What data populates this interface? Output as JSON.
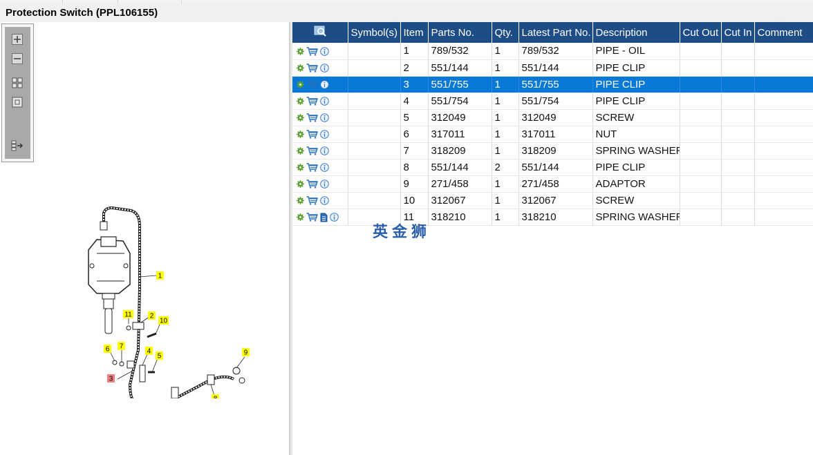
{
  "window": {
    "title": "Protection Switch (PPL106155)"
  },
  "toolbox": {
    "tools": [
      {
        "icon": "zoom-in-icon"
      },
      {
        "icon": "zoom-out-icon"
      },
      {
        "icon": "fit-all-icon"
      },
      {
        "icon": "actual-size-icon"
      },
      {
        "icon": "split-layout-icon"
      }
    ]
  },
  "diagram": {
    "callouts": [
      "1",
      "2",
      "3",
      "4",
      "5",
      "6",
      "7",
      "8",
      "8",
      "9",
      "10",
      "11"
    ],
    "highlighted_callout": "3"
  },
  "table": {
    "headers": {
      "symbols": "Symbol(s)",
      "item": "Item",
      "parts_no": "Parts No.",
      "qty": "Qty.",
      "latest_part_no": "Latest Part No.",
      "description": "Description",
      "cut_out": "Cut Out",
      "cut_in": "Cut In",
      "comment": "Comment"
    },
    "rows": [
      {
        "item": "1",
        "parts_no": "789/532",
        "qty": "1",
        "latest": "789/532",
        "description": "PIPE - OIL"
      },
      {
        "item": "2",
        "parts_no": "551/144",
        "qty": "1",
        "latest": "551/144",
        "description": "PIPE CLIP"
      },
      {
        "item": "3",
        "parts_no": "551/755",
        "qty": "1",
        "latest": "551/755",
        "description": "PIPE CLIP"
      },
      {
        "item": "4",
        "parts_no": "551/754",
        "qty": "1",
        "latest": "551/754",
        "description": "PIPE CLIP"
      },
      {
        "item": "5",
        "parts_no": "312049",
        "qty": "1",
        "latest": "312049",
        "description": "SCREW"
      },
      {
        "item": "6",
        "parts_no": "317011",
        "qty": "1",
        "latest": "317011",
        "description": "NUT"
      },
      {
        "item": "7",
        "parts_no": "318209",
        "qty": "1",
        "latest": "318209",
        "description": "SPRING WASHER"
      },
      {
        "item": "8",
        "parts_no": "551/144",
        "qty": "2",
        "latest": "551/144",
        "description": "PIPE CLIP"
      },
      {
        "item": "9",
        "parts_no": "271/458",
        "qty": "1",
        "latest": "271/458",
        "description": "ADAPTOR"
      },
      {
        "item": "10",
        "parts_no": "312067",
        "qty": "1",
        "latest": "312067",
        "description": "SCREW"
      },
      {
        "item": "11",
        "parts_no": "318210",
        "qty": "1",
        "latest": "318210",
        "description": "SPRING WASHER"
      }
    ],
    "selected_item": "3"
  },
  "watermark": "英金狮",
  "colors": {
    "header_bg": "#1d4c86",
    "selected_row": "#0a78d7",
    "callout_yellow": "#ffff00",
    "callout_highlight": "#f08080"
  }
}
